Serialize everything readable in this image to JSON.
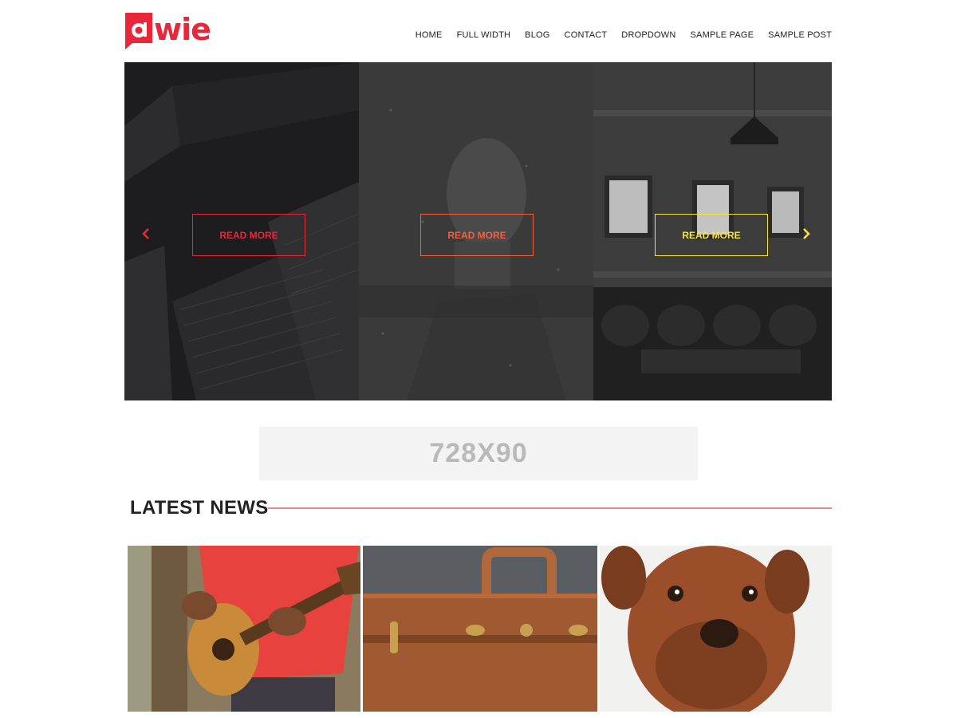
{
  "site": {
    "logo_text": "wie",
    "logo_letter": "a",
    "brand_color": "#e8283a"
  },
  "nav": {
    "items": [
      "HOME",
      "FULL WIDTH",
      "BLOG",
      "CONTACT",
      "DROPDOWN",
      "SAMPLE PAGE",
      "SAMPLE POST"
    ]
  },
  "slider": {
    "slides": [
      {
        "button_label": "READ MORE",
        "accent": "#e8283a"
      },
      {
        "button_label": "READ MORE",
        "accent": "#f4603a"
      },
      {
        "button_label": "READ MORE",
        "accent": "#f7e246"
      }
    ],
    "prev_icon": "chevron-left-icon",
    "next_icon": "chevron-right-icon"
  },
  "ad": {
    "label": "728X90"
  },
  "latest_news": {
    "title": "LATEST NEWS",
    "items": [
      {
        "image": "guitar-photo"
      },
      {
        "image": "suitcase-photo"
      },
      {
        "image": "dog-photo"
      }
    ]
  }
}
